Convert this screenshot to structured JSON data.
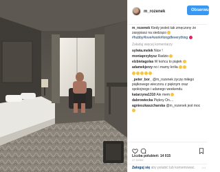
{
  "post": {
    "username": "m_rozenek",
    "follow_label": "Obserwuj"
  },
  "caption": {
    "author": "m_rozenek",
    "text": "Kiedy jesteś tak zmęczony że zasypiasz na siedząco",
    "hashtags": "#hubby#love#work#longdfeverything"
  },
  "comments": {
    "load_more": "Załaduj więcej komentarzy",
    "items": [
      {
        "user": "sylwia.melek",
        "text": "Nice !"
      },
      {
        "user": "moniaprzybysz",
        "text": "Radzio"
      },
      {
        "user": "elzbietagolas",
        "text": "W końcu to piątek"
      },
      {
        "user": "adamekjerzy",
        "text": "no i mamy króla"
      },
      {
        "user": "",
        "text": ""
      },
      {
        "user": "_peter_bor_",
        "text": "@m_rozenek życzę miłego piątkowego wieczoru z pięknym oraz spokojnego i udanego weekendu"
      },
      {
        "user": "katarzyna1310",
        "text": "Ale mem"
      },
      {
        "user": "dabrowiecka",
        "text": "Piękny On...."
      },
      {
        "user": "agnieszkaszcharska",
        "text": "@m_rozenek jest moc"
      }
    ]
  },
  "icons": {
    "like": "heart-icon",
    "comment": "comment-icon",
    "save": "bookmark-icon"
  },
  "likes_text": "Liczba polubień: 14 015",
  "date_text": "17 GODZ.",
  "footer": {
    "login_label": "Zaloguj się",
    "rest_text": "aby polubić lub komentować.",
    "more_label": "⋯"
  },
  "colors": {
    "accent": "#3897f0",
    "link": "#003569",
    "muted": "#999999"
  }
}
